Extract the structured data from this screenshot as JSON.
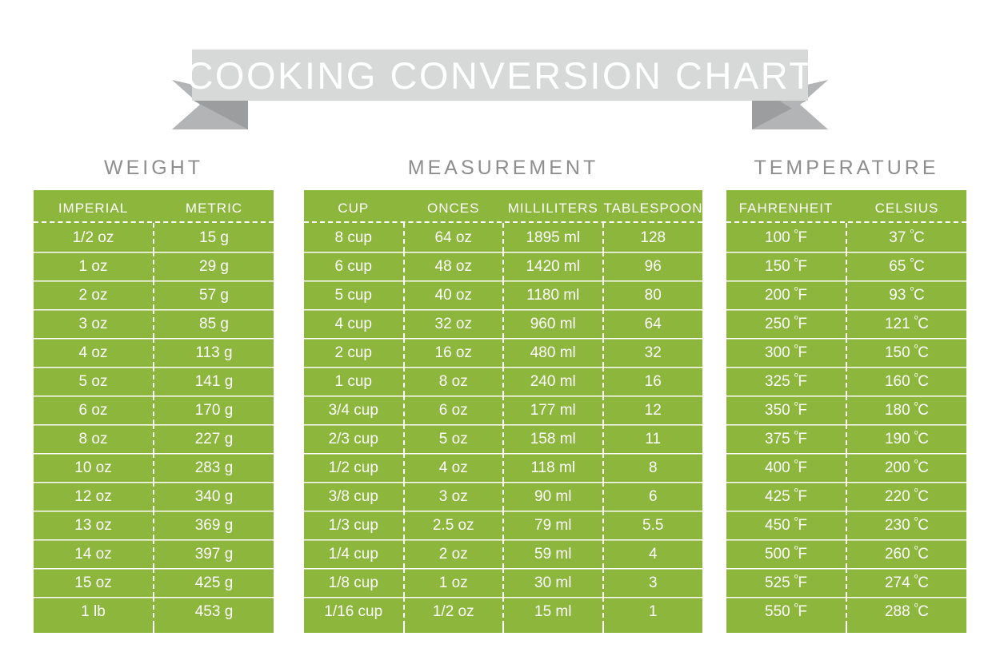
{
  "banner": {
    "title": "COOKING CONVERSION CHART",
    "body_color": "#d7d8d8",
    "tail_color": "#b2b4b5",
    "fold_color": "#9b9d9e"
  },
  "theme": {
    "table_green": "#8cb63c",
    "text_white": "#ffffff",
    "section_title_gray": "#8e8e8e"
  },
  "sections": [
    {
      "id": "weight",
      "title": "WEIGHT",
      "columns": [
        "IMPERIAL",
        "METRIC"
      ],
      "rows": [
        [
          "1/2 oz",
          "15 g"
        ],
        [
          "1 oz",
          "29 g"
        ],
        [
          "2 oz",
          "57 g"
        ],
        [
          "3 oz",
          "85 g"
        ],
        [
          "4 oz",
          "113 g"
        ],
        [
          "5 oz",
          "141 g"
        ],
        [
          "6 oz",
          "170 g"
        ],
        [
          "8 oz",
          "227 g"
        ],
        [
          "10 oz",
          "283 g"
        ],
        [
          "12 oz",
          "340 g"
        ],
        [
          "13 oz",
          "369 g"
        ],
        [
          "14 oz",
          "397 g"
        ],
        [
          "15 oz",
          "425 g"
        ],
        [
          "1 lb",
          "453 g"
        ]
      ]
    },
    {
      "id": "measurement",
      "title": "MEASUREMENT",
      "columns": [
        "CUP",
        "ONCES",
        "MILLILITERS",
        "TABLESPOONS"
      ],
      "rows": [
        [
          "8 cup",
          "64 oz",
          "1895 ml",
          "128"
        ],
        [
          "6 cup",
          "48 oz",
          "1420 ml",
          "96"
        ],
        [
          "5 cup",
          "40 oz",
          "1180 ml",
          "80"
        ],
        [
          "4 cup",
          "32 oz",
          "960 ml",
          "64"
        ],
        [
          "2 cup",
          "16 oz",
          "480 ml",
          "32"
        ],
        [
          "1 cup",
          "8 oz",
          "240 ml",
          "16"
        ],
        [
          "3/4 cup",
          "6 oz",
          "177 ml",
          "12"
        ],
        [
          "2/3 cup",
          "5 oz",
          "158 ml",
          "11"
        ],
        [
          "1/2 cup",
          "4 oz",
          "118 ml",
          "8"
        ],
        [
          "3/8 cup",
          "3 oz",
          "90 ml",
          "6"
        ],
        [
          "1/3 cup",
          "2.5 oz",
          "79 ml",
          "5.5"
        ],
        [
          "1/4 cup",
          "2 oz",
          "59 ml",
          "4"
        ],
        [
          "1/8 cup",
          "1 oz",
          "30 ml",
          "3"
        ],
        [
          "1/16 cup",
          "1/2 oz",
          "15 ml",
          "1"
        ]
      ]
    },
    {
      "id": "temperature",
      "title": "TEMPERATURE",
      "columns": [
        "FAHRENHEIT",
        "CELSIUS"
      ],
      "rows": [
        [
          "100 ºF",
          "37 ºC"
        ],
        [
          "150 ºF",
          "65 ºC"
        ],
        [
          "200 ºF",
          "93 ºC"
        ],
        [
          "250 ºF",
          "121 ºC"
        ],
        [
          "300 ºF",
          "150 ºC"
        ],
        [
          "325 ºF",
          "160 ºC"
        ],
        [
          "350 ºF",
          "180 ºC"
        ],
        [
          "375 ºF",
          "190 ºC"
        ],
        [
          "400 ºF",
          "200 ºC"
        ],
        [
          "425 ºF",
          "220 ºC"
        ],
        [
          "450 ºF",
          "230 ºC"
        ],
        [
          "500 ºF",
          "260 ºC"
        ],
        [
          "525 ºF",
          "274 ºC"
        ],
        [
          "550 ºF",
          "288 ºC"
        ]
      ]
    }
  ]
}
